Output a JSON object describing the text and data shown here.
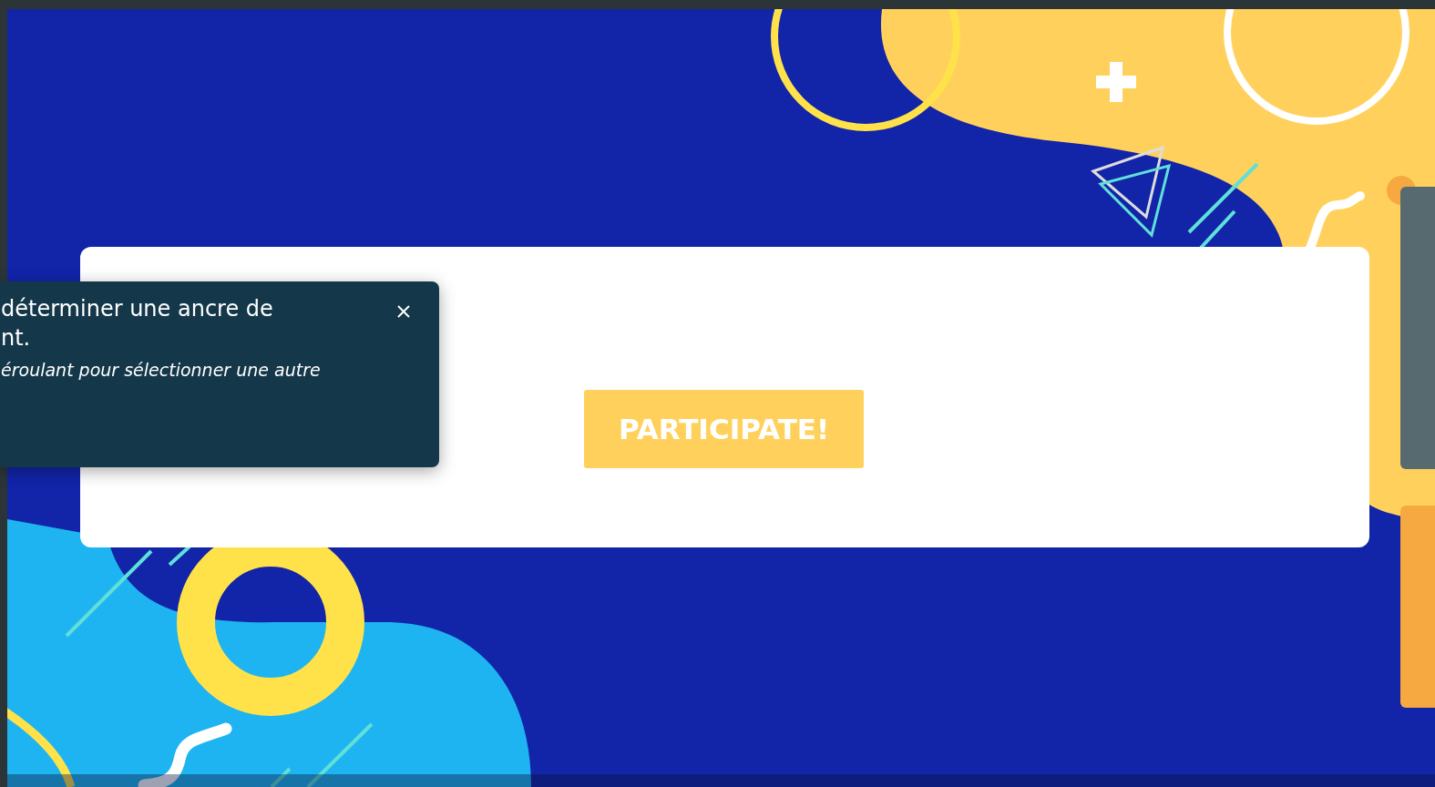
{
  "tooltip": {
    "title": "déterminer une ancre de nt.",
    "body": "éroulant pour sélectionner une autre"
  },
  "card": {
    "button": "PARTICIPATE!"
  }
}
